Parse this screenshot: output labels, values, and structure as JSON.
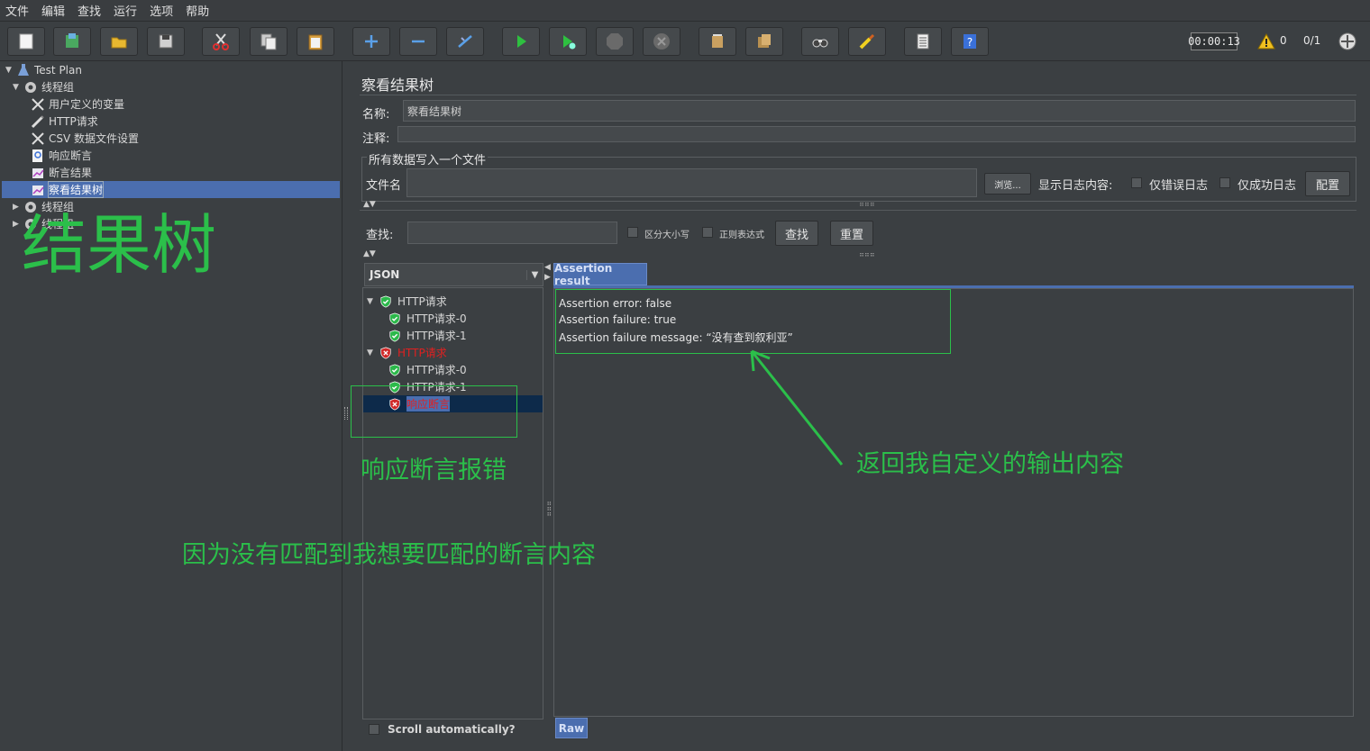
{
  "menu": [
    "文件",
    "编辑",
    "查找",
    "运行",
    "选项",
    "帮助"
  ],
  "toolbar": {
    "icons": [
      "new-icon",
      "templates-icon",
      "open-icon",
      "save-icon",
      "cut-icon",
      "copy-icon",
      "paste-icon",
      "expand-icon",
      "collapse-icon",
      "toggle-icon",
      "start-icon",
      "start-no-pause-icon",
      "stop-icon",
      "shutdown-icon",
      "clear-icon",
      "clear-all-icon",
      "search-icon",
      "reset-search-icon",
      "function-helper-icon",
      "help-icon"
    ],
    "timer": "00:00:13",
    "warn_count": "0",
    "thread_ratio": "0/1"
  },
  "tree": {
    "test_plan": "Test Plan",
    "thread_group": "线程组",
    "user_vars": "用户定义的变量",
    "http_request": "HTTP请求",
    "csv_config": "CSV 数据文件设置",
    "response_assertion": "响应断言",
    "assertion_results": "断言结果",
    "view_results_tree": "察看结果树",
    "thread_group_2": "线程组",
    "thread_group_3": "线程组"
  },
  "panel": {
    "title": "察看结果树",
    "name_label": "名称:",
    "name_value": "察看结果树",
    "comment_label": "注释:",
    "comment_value": "",
    "file_section": "所有数据写入一个文件",
    "file_label": "文件名",
    "file_value": "",
    "browse": "浏览...",
    "log_label": "显示日志内容:",
    "errors_only": "仅错误日志",
    "success_only": "仅成功日志",
    "configure": "配置",
    "search_label": "查找:",
    "search_value": "",
    "case_sensitive": "区分大小写",
    "regex": "正则表达式",
    "search_btn": "查找",
    "reset_btn": "重置"
  },
  "results": {
    "renderer": "JSON",
    "items": [
      {
        "label": "HTTP请求",
        "status": "pass",
        "level": 0
      },
      {
        "label": "HTTP请求-0",
        "status": "pass",
        "level": 1
      },
      {
        "label": "HTTP请求-1",
        "status": "pass",
        "level": 1
      },
      {
        "label": "HTTP请求",
        "status": "fail",
        "level": 0
      },
      {
        "label": "HTTP请求-0",
        "status": "pass",
        "level": 1
      },
      {
        "label": "HTTP请求-1",
        "status": "pass",
        "level": 1
      },
      {
        "label": "响应断言",
        "status": "fail",
        "level": 1
      }
    ],
    "scroll_auto": "Scroll automatically?",
    "tab": "Assertion result",
    "raw_tab": "Raw",
    "lines": [
      "Assertion error: false",
      "Assertion failure: true",
      "Assertion failure message: “没有查到叙利亚”"
    ]
  },
  "annotations": {
    "big_title": "结果树",
    "assert_error": "响应断言报错",
    "custom_output": "返回我自定义的输出内容",
    "reason": "因为没有匹配到我想要匹配的断言内容"
  },
  "colors": {
    "background": "#3b3f42",
    "annotation_green": "#2bbf4a",
    "selection": "#4b6eaf",
    "error_red": "#e02020"
  }
}
